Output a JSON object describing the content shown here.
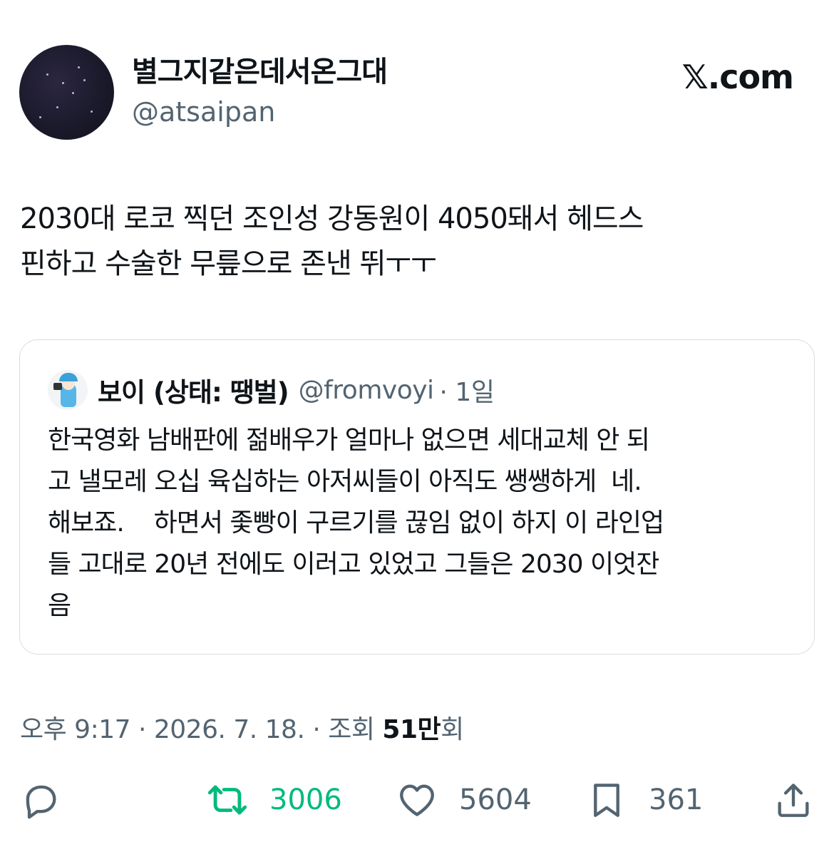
{
  "author": {
    "display_name": "별그지같은데서온그대",
    "handle": "@atsaipan"
  },
  "brand": "𝕏.com",
  "tweet": {
    "text": "2030대 로코 찍던 조인성 강동원이 4050돼서 헤드스\n핀하고 수술한 무릎으로 존낸 뛰ㅜㅜ"
  },
  "quote": {
    "display_name": "보이 (상태: 땡벌)",
    "handle": "@fromvoyi",
    "time": "· 1일",
    "text": "한국영화 남배판에 젊배우가 얼마나 없으면 세대교체 안 되\n고 낼모레 오십 육십하는 아저씨들이 아직도 쌩쌩하게  네.\n해보죠.    하면서 좇빵이 구르기를 끊임 없이 하지 이 라인업\n들 고대로 20년 전에도 이러고 있었고 그들은 2030 이엇잔\n음"
  },
  "meta": {
    "time": "오후 9:17 · 2026. 7. 18. · 조회 ",
    "views": "51만",
    "views_suffix": "회"
  },
  "actions": {
    "reply_icon": "reply-icon",
    "retweets": "3006",
    "likes": "5604",
    "bookmarks": "361",
    "share_icon": "share-icon",
    "retweet_color": "#00ba7c",
    "muted_color": "#536471"
  }
}
